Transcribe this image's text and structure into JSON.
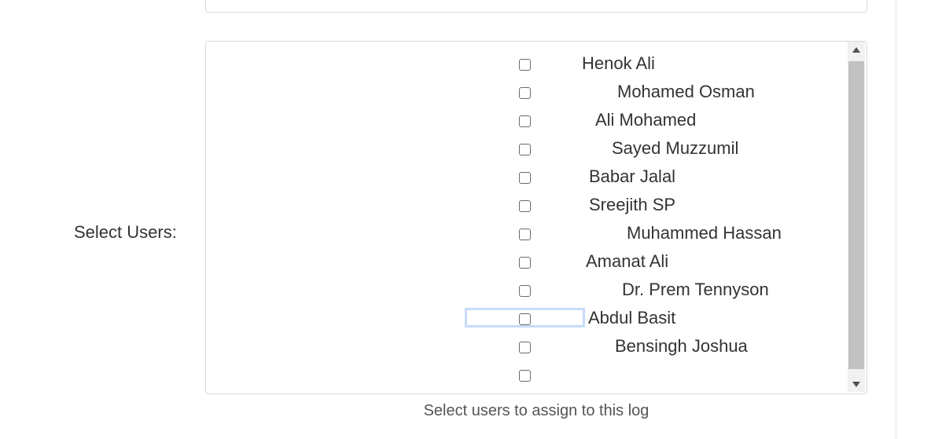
{
  "form": {
    "select_users_label": "Select Users:",
    "help_text": "Select users to assign to this log"
  },
  "users": [
    {
      "name": "Henok Ali",
      "checked": false
    },
    {
      "name": "Mohamed Osman",
      "checked": false
    },
    {
      "name": "Ali Mohamed",
      "checked": false
    },
    {
      "name": "Sayed Muzzumil",
      "checked": false
    },
    {
      "name": "Babar Jalal",
      "checked": false
    },
    {
      "name": "Sreejith SP",
      "checked": false
    },
    {
      "name": "Muhammed Hassan",
      "checked": false
    },
    {
      "name": "Amanat Ali",
      "checked": false
    },
    {
      "name": "Dr. Prem Tennyson",
      "checked": false
    },
    {
      "name": "Abdul Basit",
      "checked": false
    },
    {
      "name": "Bensingh Joshua",
      "checked": false
    },
    {
      "name": "",
      "checked": false
    }
  ],
  "scrollbar": {
    "up_icon": "triangle-up",
    "down_icon": "triangle-down"
  }
}
